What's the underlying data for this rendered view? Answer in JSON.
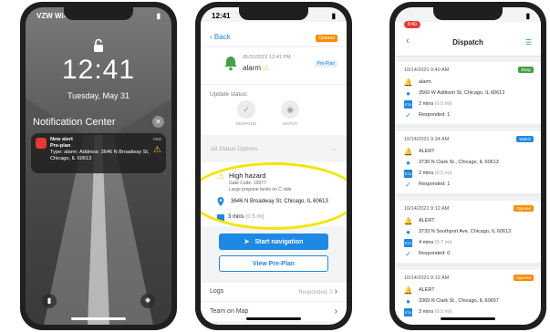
{
  "phone1": {
    "carrier": "VZW Wi-Fi",
    "time": "12:41",
    "date": "Tuesday, May 31",
    "notification_center": "Notification Center",
    "notification": {
      "title": "New alert",
      "subtitle": "Pre-plan",
      "body": "Type: alarm; Address: 3646 N Broadway St, Chicago, IL 60613",
      "time": "now"
    }
  },
  "phone2": {
    "status_time": "12:41",
    "back_label": "Back",
    "opened_badge": "Opened",
    "preplan_badge": "Pre-Plan",
    "alarm_datetime": "05/31/2022 12:41 PM",
    "alarm_title": "alarm",
    "update_status_label": "Update status:",
    "respond_label": "RESPOND",
    "watch_label": "WATCH",
    "status_options": "All Status Options",
    "hazard_title": "High hazard",
    "gate_code": "Gate Code: 19377",
    "hazard_note": "Large propane tanks on C side",
    "address": "3646 N Broadway St, Chicago, IL 60613",
    "eta": "3 mins",
    "eta_distance": "(0.5 mi)",
    "start_nav": "Start navigation",
    "view_preplan": "View Pre-Plan",
    "logs_label": "Logs",
    "logs_count": "Responded: 0",
    "team_label": "Team on Map"
  },
  "phone3": {
    "status_time": "9:40",
    "title": "Dispatch",
    "cards": [
      {
        "date": "10/14/2021 9:40 AM",
        "badge": "Resp",
        "badge_color": "#43a047",
        "type": "alarm",
        "address": "3560 W Addison St, Chicago, IL 60613",
        "eta": "2 mins",
        "eta_distance": "(0.5 mi)",
        "responded": "Responded: 1"
      },
      {
        "date": "10/14/2021 9:34 AM",
        "badge": "Watch",
        "badge_color": "#1e88e5",
        "type": "ALERT",
        "address": "3730 N Clark St., Chicago, IL 60613",
        "eta": "2 mins",
        "eta_distance": "(0.5 mi)",
        "responded": "Responded: 1"
      },
      {
        "date": "10/14/2021 9:12 AM",
        "badge": "Opened",
        "badge_color": "#fb8c00",
        "type": "ALERT",
        "address": "3733 N Southport Ave, Chicago, IL 60613",
        "eta": "4 mins",
        "eta_distance": "(0.7 mi)",
        "responded": "Responded: 0"
      },
      {
        "date": "10/14/2021 9:12 AM",
        "badge": "Opened",
        "badge_color": "#fb8c00",
        "type": "ALERT",
        "address": "3369 N Clark St., Chicago, IL 60657",
        "eta": "3 mins",
        "eta_distance": "(0.5 mi)",
        "responded": ""
      }
    ]
  }
}
